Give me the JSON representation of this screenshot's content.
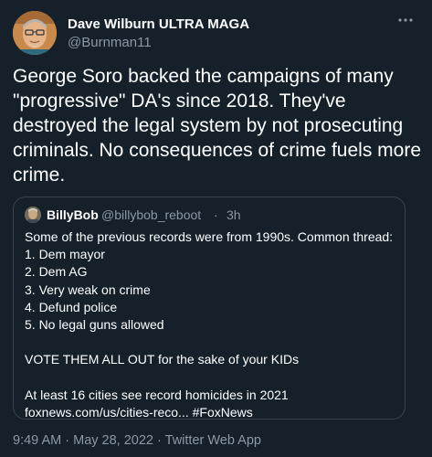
{
  "author": {
    "display_name": "Dave Wilburn ULTRA MAGA",
    "handle": "@Burnman11"
  },
  "more_icon": "more-horizontal-icon",
  "tweet_text": "George Soro backed the campaigns of many \"progressive\" DA's since 2018. They've destroyed the legal system by not prosecuting criminals. No consequences of crime fuels more crime.",
  "quoted": {
    "name": "BillyBob",
    "handle": "@billybob_reboot",
    "separator": "·",
    "time": "3h",
    "lines": [
      "Some of the previous records were from 1990s.  Common thread:",
      "1. Dem mayor",
      "2. Dem AG",
      "3. Very weak on crime",
      "4. Defund police",
      "5. No legal guns allowed",
      "",
      "VOTE THEM ALL OUT for the sake of your KIDs",
      "",
      "At least 16 cities see record homicides in 2021",
      "foxnews.com/us/cities-reco... #FoxNews"
    ]
  },
  "meta": {
    "time": "9:49 AM",
    "separator1": "·",
    "date": "May 28, 2022",
    "separator2": "·",
    "source": "Twitter Web App"
  },
  "colors": {
    "background": "#15202b",
    "secondary_text": "#8b98a5",
    "border": "#38444d"
  }
}
